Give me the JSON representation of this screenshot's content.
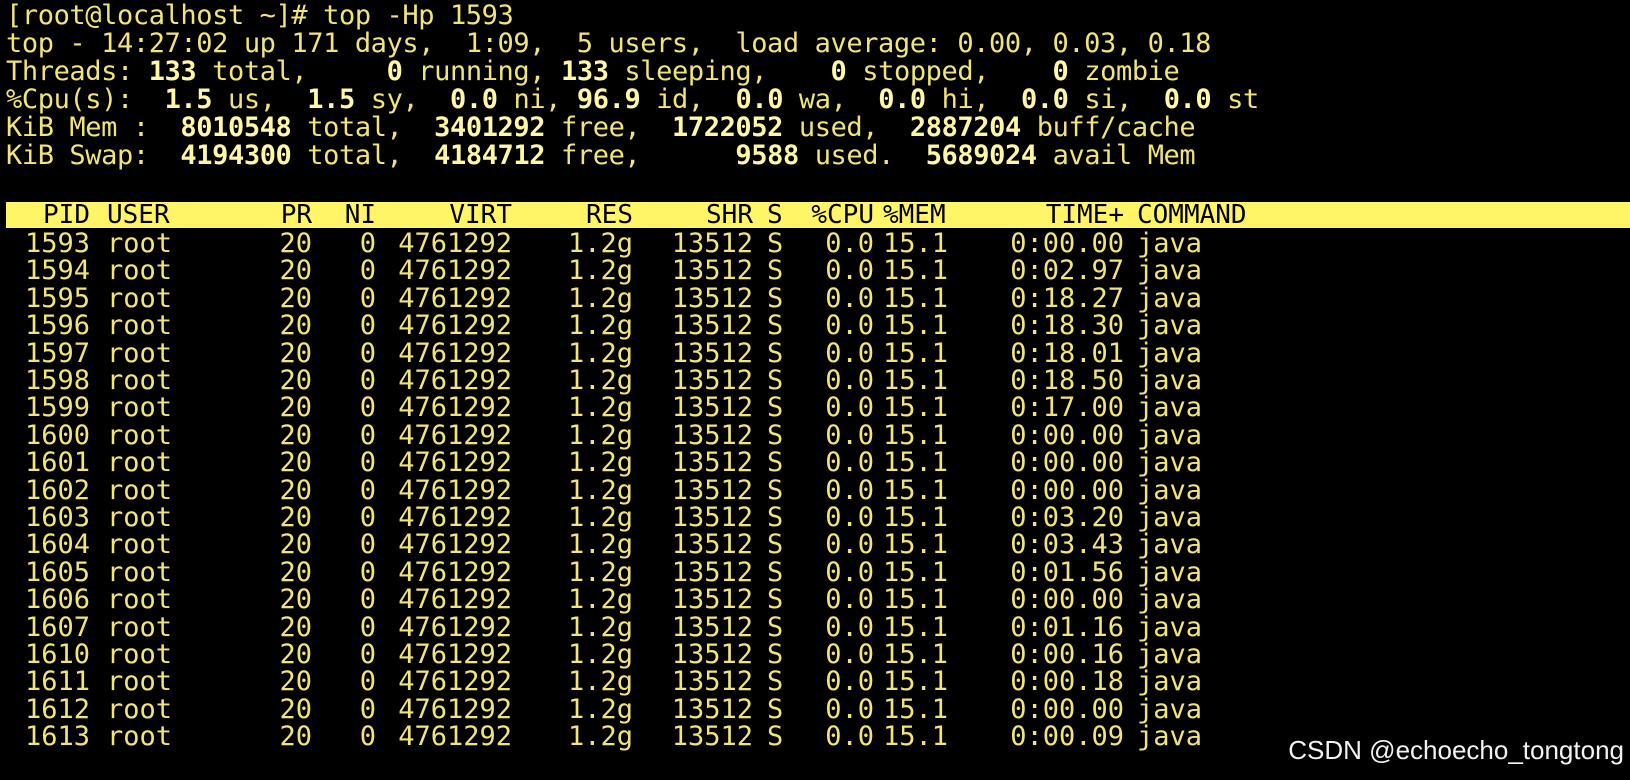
{
  "prompt_line": "[root@localhost ~]# top -Hp 1593",
  "top_line": "top - 14:27:02 up 171 days,  1:09,  5 users,  load average: 0.00, 0.03, 0.18",
  "threads": {
    "label": "Threads:",
    "total": "133",
    "total_label": "total,",
    "running": "0",
    "running_label": "running,",
    "sleeping": "133",
    "sleeping_label": "sleeping,",
    "stopped": "0",
    "stopped_label": "stopped,",
    "zombie": "0",
    "zombie_label": "zombie"
  },
  "cpu": {
    "label": "%Cpu(s):",
    "us": "1.5",
    "us_label": "us,",
    "sy": "1.5",
    "sy_label": "sy,",
    "ni": "0.0",
    "ni_label": "ni,",
    "id": "96.9",
    "id_label": "id,",
    "wa": "0.0",
    "wa_label": "wa,",
    "hi": "0.0",
    "hi_label": "hi,",
    "si": "0.0",
    "si_label": "si,",
    "st": "0.0",
    "st_label": "st"
  },
  "mem": {
    "label": "KiB Mem :",
    "total": "8010548",
    "total_label": "total,",
    "free": "3401292",
    "free_label": "free,",
    "used": "1722052",
    "used_label": "used,",
    "buff": "2887204",
    "buff_label": "buff/cache"
  },
  "swap": {
    "label": "KiB Swap:",
    "total": "4194300",
    "total_label": "total,",
    "free": "4184712",
    "free_label": "free,",
    "used": "9588",
    "used_label": "used.",
    "avail": "5689024",
    "avail_label": "avail Mem"
  },
  "columns": {
    "pid": "PID",
    "user": "USER",
    "pr": "PR",
    "ni": "NI",
    "virt": "VIRT",
    "res": "RES",
    "shr": "SHR",
    "s": "S",
    "cpu": "%CPU",
    "mem": "%MEM",
    "time": "TIME+",
    "command": "COMMAND"
  },
  "rows": [
    {
      "pid": "1593",
      "user": "root",
      "pr": "20",
      "ni": "0",
      "virt": "4761292",
      "res": "1.2g",
      "shr": "13512",
      "s": "S",
      "cpu": "0.0",
      "mem": "15.1",
      "time": "0:00.00",
      "command": "java"
    },
    {
      "pid": "1594",
      "user": "root",
      "pr": "20",
      "ni": "0",
      "virt": "4761292",
      "res": "1.2g",
      "shr": "13512",
      "s": "S",
      "cpu": "0.0",
      "mem": "15.1",
      "time": "0:02.97",
      "command": "java"
    },
    {
      "pid": "1595",
      "user": "root",
      "pr": "20",
      "ni": "0",
      "virt": "4761292",
      "res": "1.2g",
      "shr": "13512",
      "s": "S",
      "cpu": "0.0",
      "mem": "15.1",
      "time": "0:18.27",
      "command": "java"
    },
    {
      "pid": "1596",
      "user": "root",
      "pr": "20",
      "ni": "0",
      "virt": "4761292",
      "res": "1.2g",
      "shr": "13512",
      "s": "S",
      "cpu": "0.0",
      "mem": "15.1",
      "time": "0:18.30",
      "command": "java"
    },
    {
      "pid": "1597",
      "user": "root",
      "pr": "20",
      "ni": "0",
      "virt": "4761292",
      "res": "1.2g",
      "shr": "13512",
      "s": "S",
      "cpu": "0.0",
      "mem": "15.1",
      "time": "0:18.01",
      "command": "java"
    },
    {
      "pid": "1598",
      "user": "root",
      "pr": "20",
      "ni": "0",
      "virt": "4761292",
      "res": "1.2g",
      "shr": "13512",
      "s": "S",
      "cpu": "0.0",
      "mem": "15.1",
      "time": "0:18.50",
      "command": "java"
    },
    {
      "pid": "1599",
      "user": "root",
      "pr": "20",
      "ni": "0",
      "virt": "4761292",
      "res": "1.2g",
      "shr": "13512",
      "s": "S",
      "cpu": "0.0",
      "mem": "15.1",
      "time": "0:17.00",
      "command": "java"
    },
    {
      "pid": "1600",
      "user": "root",
      "pr": "20",
      "ni": "0",
      "virt": "4761292",
      "res": "1.2g",
      "shr": "13512",
      "s": "S",
      "cpu": "0.0",
      "mem": "15.1",
      "time": "0:00.00",
      "command": "java"
    },
    {
      "pid": "1601",
      "user": "root",
      "pr": "20",
      "ni": "0",
      "virt": "4761292",
      "res": "1.2g",
      "shr": "13512",
      "s": "S",
      "cpu": "0.0",
      "mem": "15.1",
      "time": "0:00.00",
      "command": "java"
    },
    {
      "pid": "1602",
      "user": "root",
      "pr": "20",
      "ni": "0",
      "virt": "4761292",
      "res": "1.2g",
      "shr": "13512",
      "s": "S",
      "cpu": "0.0",
      "mem": "15.1",
      "time": "0:00.00",
      "command": "java"
    },
    {
      "pid": "1603",
      "user": "root",
      "pr": "20",
      "ni": "0",
      "virt": "4761292",
      "res": "1.2g",
      "shr": "13512",
      "s": "S",
      "cpu": "0.0",
      "mem": "15.1",
      "time": "0:03.20",
      "command": "java"
    },
    {
      "pid": "1604",
      "user": "root",
      "pr": "20",
      "ni": "0",
      "virt": "4761292",
      "res": "1.2g",
      "shr": "13512",
      "s": "S",
      "cpu": "0.0",
      "mem": "15.1",
      "time": "0:03.43",
      "command": "java"
    },
    {
      "pid": "1605",
      "user": "root",
      "pr": "20",
      "ni": "0",
      "virt": "4761292",
      "res": "1.2g",
      "shr": "13512",
      "s": "S",
      "cpu": "0.0",
      "mem": "15.1",
      "time": "0:01.56",
      "command": "java"
    },
    {
      "pid": "1606",
      "user": "root",
      "pr": "20",
      "ni": "0",
      "virt": "4761292",
      "res": "1.2g",
      "shr": "13512",
      "s": "S",
      "cpu": "0.0",
      "mem": "15.1",
      "time": "0:00.00",
      "command": "java"
    },
    {
      "pid": "1607",
      "user": "root",
      "pr": "20",
      "ni": "0",
      "virt": "4761292",
      "res": "1.2g",
      "shr": "13512",
      "s": "S",
      "cpu": "0.0",
      "mem": "15.1",
      "time": "0:01.16",
      "command": "java"
    },
    {
      "pid": "1610",
      "user": "root",
      "pr": "20",
      "ni": "0",
      "virt": "4761292",
      "res": "1.2g",
      "shr": "13512",
      "s": "S",
      "cpu": "0.0",
      "mem": "15.1",
      "time": "0:00.16",
      "command": "java"
    },
    {
      "pid": "1611",
      "user": "root",
      "pr": "20",
      "ni": "0",
      "virt": "4761292",
      "res": "1.2g",
      "shr": "13512",
      "s": "S",
      "cpu": "0.0",
      "mem": "15.1",
      "time": "0:00.18",
      "command": "java"
    },
    {
      "pid": "1612",
      "user": "root",
      "pr": "20",
      "ni": "0",
      "virt": "4761292",
      "res": "1.2g",
      "shr": "13512",
      "s": "S",
      "cpu": "0.0",
      "mem": "15.1",
      "time": "0:00.00",
      "command": "java"
    },
    {
      "pid": "1613",
      "user": "root",
      "pr": "20",
      "ni": "0",
      "virt": "4761292",
      "res": "1.2g",
      "shr": "13512",
      "s": "S",
      "cpu": "0.0",
      "mem": "15.1",
      "time": "0:00.09",
      "command": "java"
    }
  ],
  "watermark": "CSDN @echoecho_tongtong",
  "colors": {
    "background": "#000000",
    "text": "#f0e47a",
    "bold_text": "#fff7a8",
    "header_bar": "#fff566"
  }
}
